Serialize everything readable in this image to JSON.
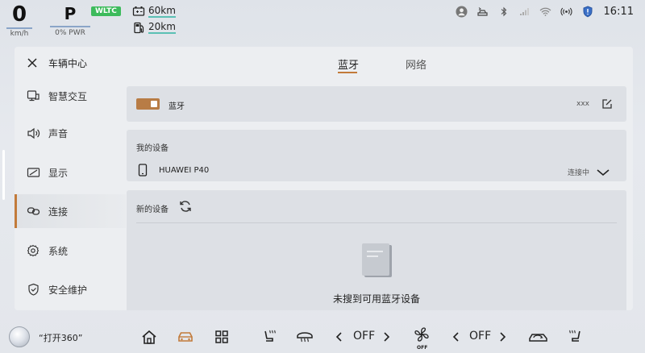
{
  "status": {
    "speed": "0",
    "speed_unit": "km/h",
    "gear": "P",
    "power": "0% PWR",
    "wltc": "WLTC",
    "range_battery": "60km",
    "range_fuel": "20km",
    "time": "16:11"
  },
  "panel": {
    "title": "车辆中心",
    "tabs": [
      {
        "label": "蓝牙",
        "active": true
      },
      {
        "label": "网络",
        "active": false
      }
    ]
  },
  "sidebar": {
    "items": [
      {
        "label": "智慧交互",
        "icon": "smart-interaction-icon"
      },
      {
        "label": "声音",
        "icon": "speaker-icon"
      },
      {
        "label": "显示",
        "icon": "display-icon"
      },
      {
        "label": "连接",
        "icon": "link-icon",
        "active": true
      },
      {
        "label": "系统",
        "icon": "gear-icon"
      },
      {
        "label": "安全维护",
        "icon": "shield-icon"
      }
    ]
  },
  "bluetooth": {
    "label": "蓝牙",
    "enabled": true,
    "device_name": "xxx"
  },
  "my_devices": {
    "title": "我的设备",
    "devices": [
      {
        "name": "HUAWEI P40",
        "status": "连接中"
      }
    ]
  },
  "new_devices": {
    "title": "新的设备",
    "empty_text": "未搜到可用蓝牙设备"
  },
  "dock": {
    "voice_hint": "“打开360”",
    "left_temp": "OFF",
    "right_temp": "OFF",
    "fan_label": "OFF"
  },
  "colors": {
    "accent": "#c27a3a",
    "toggle_on": "#b87c45",
    "wltc_badge": "#3dbb5c"
  }
}
